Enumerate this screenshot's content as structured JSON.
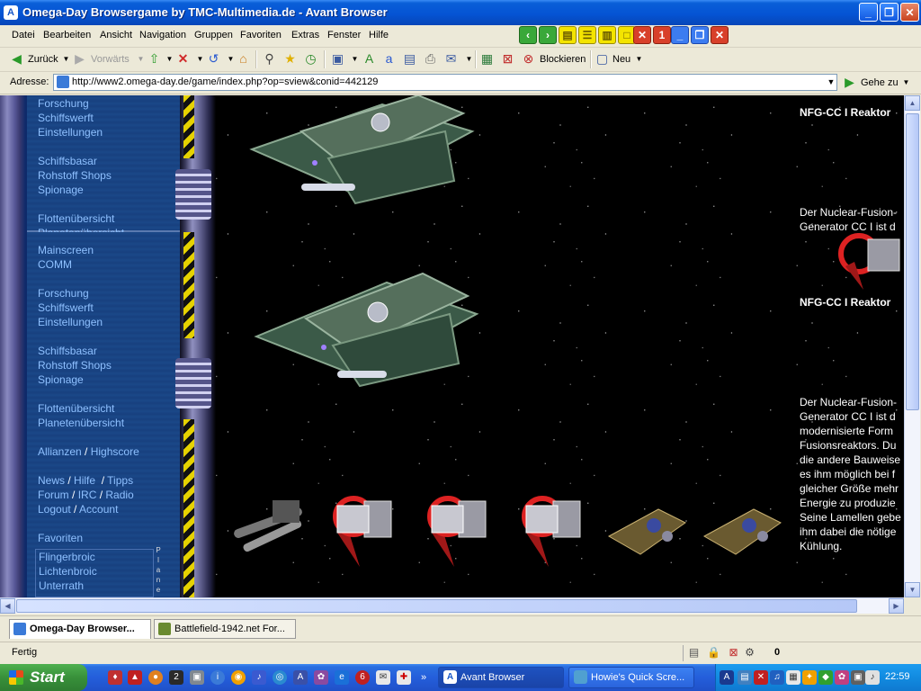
{
  "window": {
    "title": "Omega-Day Browsergame by TMC-Multimedia.de - Avant Browser",
    "app_icon": "avant-browser-icon"
  },
  "menu": [
    "Datei",
    "Bearbeiten",
    "Ansicht",
    "Navigation",
    "Gruppen",
    "Favoriten",
    "Extras",
    "Fenster",
    "Hilfe"
  ],
  "toolbar": {
    "back": "Zurück",
    "forward": "Vorwärts",
    "block": "Blockieren",
    "new": "Neu"
  },
  "tab_controls": {
    "count_badge": "1"
  },
  "address": {
    "label": "Adresse:",
    "url": "http://www2.omega-day.de/game/index.php?op=sview&conid=442129",
    "go": "Gehe zu"
  },
  "nav": {
    "top": [
      "Forschung",
      "Schiffswerft",
      "Einstellungen",
      "Schiffsbasar",
      "Rohstoff Shops",
      "Spionage",
      "Flottenübersicht",
      "Planetenübersicht"
    ],
    "main": [
      [
        "Mainscreen",
        "COMM"
      ],
      [
        "Forschung",
        "Schiffswerft",
        "Einstellungen"
      ],
      [
        "Schiffsbasar",
        "Rohstoff Shops",
        "Spionage"
      ],
      [
        "Flottenübersicht",
        "Planetenübersicht"
      ]
    ],
    "alliances": "Allianzen",
    "highscore": "Highscore",
    "news": "News",
    "hilfe": "Hilfe",
    "tipps": "Tipps",
    "forum": "Forum",
    "irc": "IRC",
    "radio": "Radio",
    "logout": "Logout",
    "account": "Account",
    "favorites_heading": "Favoriten",
    "favorites": [
      "Flingerbroic",
      "Lichtenbroic",
      "Unterrath"
    ],
    "vertical_text": "Plane"
  },
  "content": {
    "item_title_1": "NFG-CC I Reaktor",
    "item_desc_1": [
      "Der Nuclear-Fusion-",
      "Generator CC I ist d"
    ],
    "item_title_2": "NFG-CC I Reaktor",
    "item_desc_2": [
      "Der Nuclear-Fusion-",
      "Generator CC I ist d",
      "modernisierte Form",
      "Fusionsreaktors. Du",
      "die andere Bauweise",
      "es ihm möglich bei f",
      "gleicher Größe mehr",
      "Energie zu produzie",
      "Seine Lamellen gebe",
      "ihm dabei die nötige",
      "Kühlung."
    ]
  },
  "tabs": [
    {
      "label": "Omega-Day Browser...",
      "active": true
    },
    {
      "label": "Battlefield-1942.net For...",
      "active": false
    }
  ],
  "status": {
    "text": "Fertig",
    "counter": "0"
  },
  "taskbar": {
    "start": "Start",
    "buttons": [
      "Avant Browser",
      "Howie's Quick Scre..."
    ],
    "clock": "22:59"
  },
  "colors": {
    "xp_blue": "#0554d4",
    "nav_link": "#8ec0ff",
    "start_green": "#38903a"
  }
}
